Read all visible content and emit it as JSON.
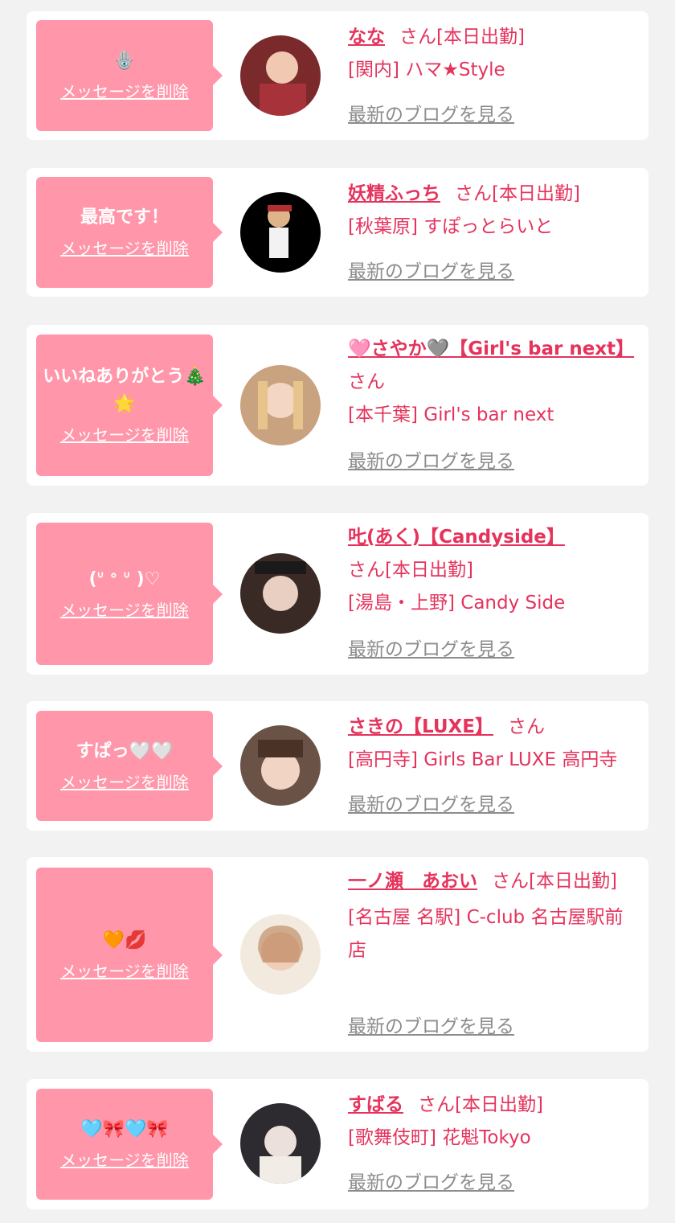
{
  "cards": [
    {
      "message": "🪬",
      "delete_label": "メッセージを削除",
      "name": "なな",
      "honorific": "さん[本日出勤]",
      "shop": "[関内] ハマ★Style",
      "blog_label": "最新のブログを見る"
    },
    {
      "message": "最高です！",
      "delete_label": "メッセージを削除",
      "name": "妖精ふっち",
      "honorific": "さん[本日出勤]",
      "shop": "[秋葉原] すぽっとらいと",
      "blog_label": "最新のブログを見る"
    },
    {
      "message": "いいねありがとう🎄🌟",
      "delete_label": "メッセージを削除",
      "name": "🩷さやか🩶【Girl's bar next】",
      "honorific": "さん",
      "shop": "[本千葉] Girl's bar next",
      "blog_label": "最新のブログを見る"
    },
    {
      "message": "(ᐡ ᐤ ᐡ )♡︎",
      "delete_label": "メッセージを削除",
      "name": "𠮟(あく)【Candyside】",
      "honorific": "さん[本日出勤]",
      "shop": "[湯島・上野] Candy Side",
      "blog_label": "最新のブログを見る"
    },
    {
      "message": "すぱっ🤍🤍",
      "delete_label": "メッセージを削除",
      "name": "さきの【LUXE】",
      "honorific": "さん",
      "shop": "[高円寺] Girls Bar LUXE 高円寺",
      "blog_label": "最新のブログを見る"
    },
    {
      "message": "🧡💋",
      "delete_label": "メッセージを削除",
      "name": "一ノ瀬　あおい",
      "honorific": "さん[本日出勤]",
      "shop": "[名古屋 名駅] C-club 名古屋駅前店",
      "blog_label": "最新のブログを見る"
    },
    {
      "message": "🩵🎀🩵🎀",
      "delete_label": "メッセージを削除",
      "name": "すばる",
      "honorific": "さん[本日出勤]",
      "shop": "[歌舞伎町] 花魁Tokyo",
      "blog_label": "最新のブログを見る"
    }
  ],
  "colors": {
    "accent": "#e5335c",
    "bubble": "#ff96aa",
    "link_gray": "#8c8c8c"
  }
}
